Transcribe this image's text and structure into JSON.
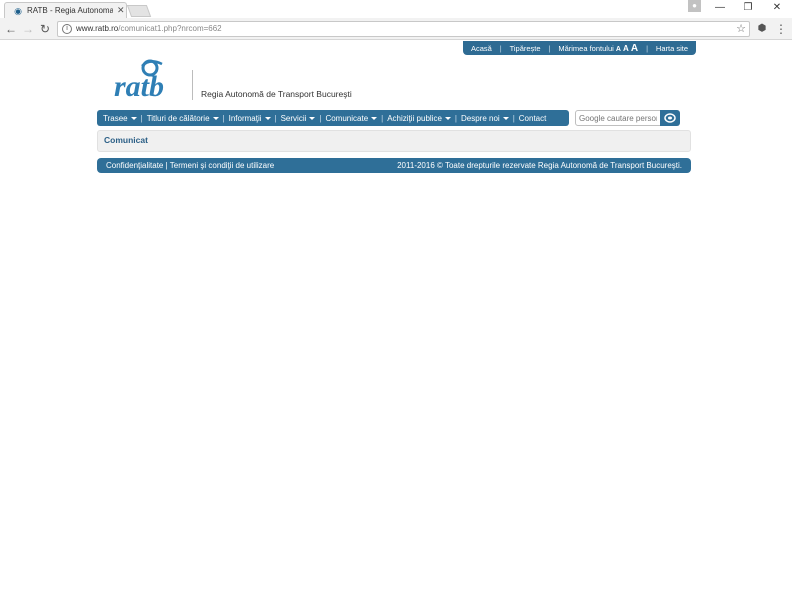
{
  "browser": {
    "tab_title": "RATB - Regia Autonoma",
    "url_host": "www.ratb.ro",
    "url_path": "/comunicat1.php?nrcom=662"
  },
  "topnav": {
    "home": "Acasă",
    "print": "Tipărește",
    "font_size": "Mărimea fontului",
    "font_small": "A",
    "font_medium": "A",
    "font_large": "A",
    "sitemap": "Harta site",
    "separator": "|"
  },
  "header": {
    "logo_text": "ratb",
    "tagline": "Regia Autonomă de Transport Bucureşti"
  },
  "menu": {
    "items": [
      {
        "label": "Trasee",
        "dropdown": true
      },
      {
        "label": "Titluri de călătorie",
        "dropdown": true
      },
      {
        "label": "Informaţii",
        "dropdown": true
      },
      {
        "label": "Servicii",
        "dropdown": true
      },
      {
        "label": "Comunicate",
        "dropdown": true
      },
      {
        "label": "Achiziţii publice",
        "dropdown": true
      },
      {
        "label": "Despre noi",
        "dropdown": true
      },
      {
        "label": "Contact",
        "dropdown": false
      }
    ],
    "separator": "|"
  },
  "search": {
    "placeholder": "Google cautare personalizata"
  },
  "content": {
    "title": "Comunicat"
  },
  "footer": {
    "left": "Confidenţialitate | Termeni şi condiţii de utilizare",
    "right": "2011-2016 © Toate drepturile rezervate Regia Autonomă de Transport Bucureşti."
  },
  "colors": {
    "brand_blue": "#2f6f98",
    "title_blue": "#2b5f86"
  }
}
